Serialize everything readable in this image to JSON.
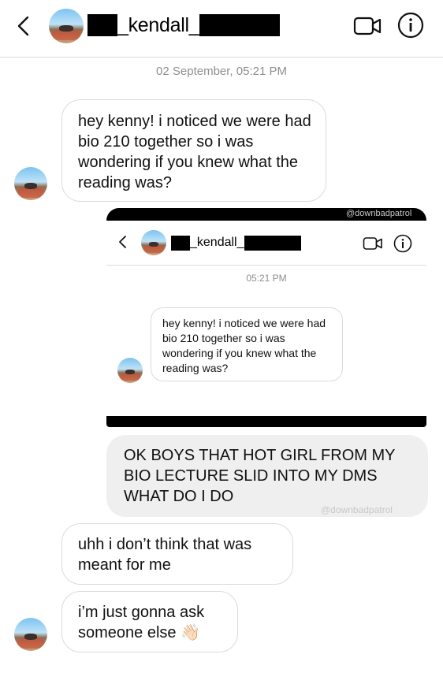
{
  "header": {
    "username_visible": "_kendall_",
    "icons": [
      "chevron-left-icon",
      "video-camera-icon",
      "info-icon"
    ]
  },
  "timestamp": "02 September, 05:21 PM",
  "messages": [
    {
      "from": "other",
      "text": "hey kenny! i noticed we were had bio 210 together so i was wondering if you knew what the reading was?"
    },
    {
      "from": "me",
      "text": "OK BOYS THAT HOT GIRL FROM MY BIO LECTURE SLID INTO MY DMS WHAT DO I DO"
    },
    {
      "from": "other",
      "text": "uhh i don’t think that was meant for me"
    },
    {
      "from": "other",
      "text": "i’m just gonna ask someone else 👋🏻"
    }
  ],
  "embedded_screenshot": {
    "watermark": "@downbadpatrol",
    "username_visible": "_kendall_",
    "timestamp": "05:21 PM",
    "message": "hey kenny! i noticed we were had bio 210 together so i was wondering if you knew what the reading was?"
  },
  "outgoing_watermark": "@downbadpatrol",
  "colors": {
    "background": "#ffffff",
    "incoming_border": "#dbdbdb",
    "outgoing_bubble": "#efefef",
    "meta_text": "#8e8e8e"
  }
}
